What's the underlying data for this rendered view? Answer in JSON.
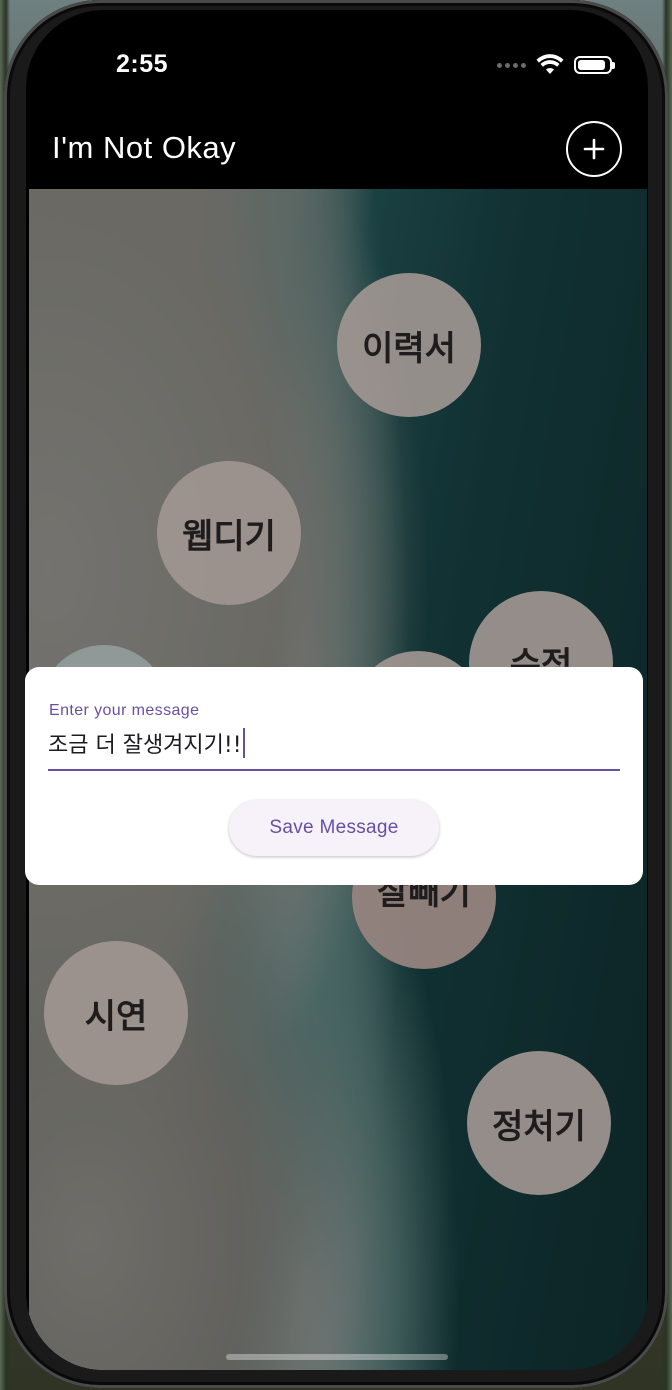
{
  "status_bar": {
    "time": "2:55",
    "signal": "signal-dots-icon",
    "wifi": "wifi-icon",
    "battery": "battery-icon",
    "battery_level": 0.9
  },
  "app_bar": {
    "title": "I'm Not Okay",
    "add_button_icon": "plus-icon"
  },
  "bubbles": [
    {
      "label": "이력서"
    },
    {
      "label": "웹디기"
    },
    {
      "label": "수정"
    },
    {
      "label": ""
    },
    {
      "label": ""
    },
    {
      "label": "잘빼기"
    },
    {
      "label": "시연"
    },
    {
      "label": "정처기"
    }
  ],
  "dialog": {
    "input_label": "Enter your message",
    "input_value": "조금 더 잘생겨지기!!",
    "save_button": "Save Message"
  },
  "colors": {
    "accent": "#6750a4",
    "bubble": "#a0968f",
    "button_bg": "#f7f2fa"
  }
}
